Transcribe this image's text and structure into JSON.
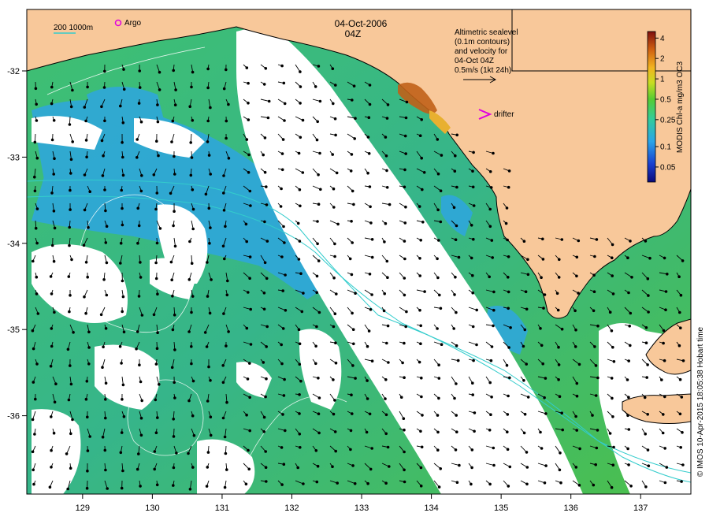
{
  "header": {
    "date": "04-Oct-2006",
    "time": "04Z"
  },
  "legend": {
    "scale_label": "200  1000m",
    "argo_label": "Argo",
    "drifter_label": "drifter",
    "argo_color": "#e000e0",
    "drifter_color": "#e000e0",
    "isobath_color": "#33cccc"
  },
  "velocity_note": {
    "lines": [
      "Altimetric sealevel",
      "(0.1m contours)",
      "and velocity for",
      "04-Oct 04Z",
      "0.5m/s (1kt 24h)"
    ]
  },
  "colorbar": {
    "title": "MODIS Chl-a mg/m3 OC3",
    "ticks": [
      "4",
      "2",
      "1",
      "0.5",
      "0.25",
      "0.1",
      "0.05"
    ],
    "tick_values": [
      4,
      2,
      1,
      0.5,
      0.25,
      0.1,
      0.05
    ],
    "range": [
      0.03,
      5
    ],
    "scale": "log",
    "stops": [
      "#0a0a7a",
      "#1a3fd0",
      "#2aa5e8",
      "#33cc99",
      "#55cc33",
      "#c8dd22",
      "#f2b420",
      "#d06010",
      "#801010"
    ]
  },
  "credit": "© IMOS 10-Apr-2015 18:05:38 Hobart time",
  "axes": {
    "x_ticks": [
      "129",
      "130",
      "131",
      "132",
      "133",
      "134",
      "135",
      "136",
      "137"
    ],
    "y_ticks": [
      "-32",
      "-33",
      "-34",
      "-35",
      "-36"
    ]
  },
  "colors": {
    "land": "#f8c89a",
    "coast": "#000000",
    "cloud": "#ffffff"
  }
}
